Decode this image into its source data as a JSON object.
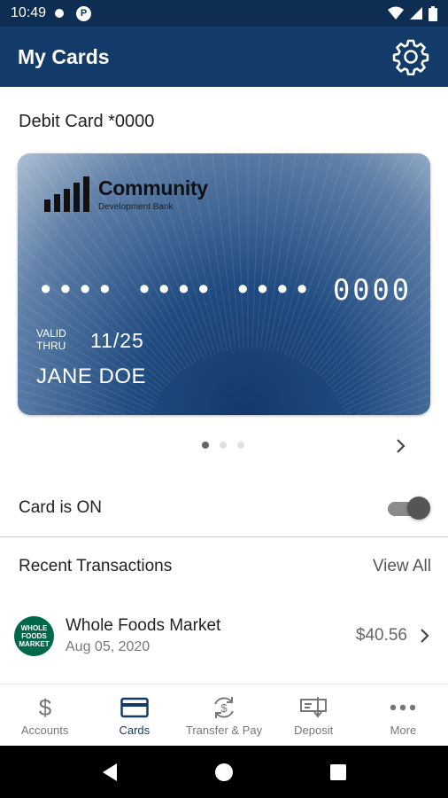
{
  "status_bar": {
    "time": "10:49",
    "notif_badge": "P"
  },
  "app_bar": {
    "title": "My Cards",
    "settings_icon": "gear-icon"
  },
  "card_section": {
    "title": "Debit Card *0000",
    "card": {
      "bank_name": "Community",
      "bank_subtitle": "Development Bank",
      "number_masked": "•••• •••• •••• 0000",
      "valid_label_1": "VALID",
      "valid_label_2": "THRU",
      "expiry": "11/25",
      "holder": "JANE DOE"
    },
    "pager": {
      "count": 3,
      "active_index": 0
    }
  },
  "card_toggle": {
    "label": "Card is ON",
    "on": true
  },
  "transactions": {
    "header": "Recent Transactions",
    "view_all": "View All",
    "items": [
      {
        "merchant": "Whole Foods Market",
        "date": "Aug 05, 2020",
        "amount": "$40.56",
        "logo_text": "WHOLE FOODS MARKET"
      }
    ]
  },
  "bottom_nav": [
    {
      "label": "Accounts",
      "icon": "dollar-icon",
      "active": false
    },
    {
      "label": "Cards",
      "icon": "card-icon",
      "active": true
    },
    {
      "label": "Transfer & Pay",
      "icon": "transfer-icon",
      "active": false
    },
    {
      "label": "Deposit",
      "icon": "check-deposit-icon",
      "active": false
    },
    {
      "label": "More",
      "icon": "more-icon",
      "active": false
    }
  ],
  "colors": {
    "primary": "#133b69",
    "status_bar": "#0d2d52",
    "whole_foods_green": "#00674b"
  }
}
